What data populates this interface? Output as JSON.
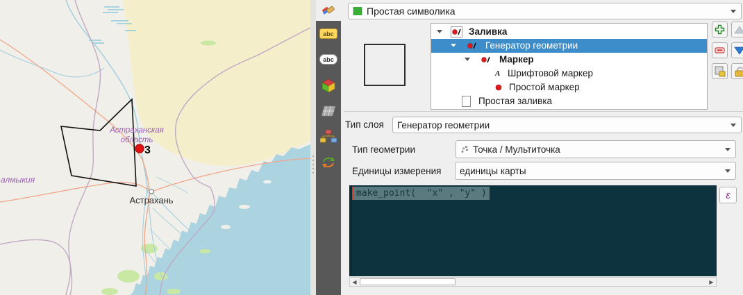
{
  "colors": {
    "selection_blue": "#3c8dca",
    "editor_background": "#0c333e",
    "editor_selection": "#5b7a80",
    "marker_red": "#e31212",
    "map_sand": "#f5eecb",
    "map_water": "#abd4e0",
    "map_green": "#c9e8a4",
    "boundary_purple": "#bfa9c4",
    "road_salmon": "#f0a589"
  },
  "map": {
    "region_label_line1": "Астраханская",
    "region_label_line2": "область",
    "city_label": "Астрахань",
    "area_label": "алмыкия",
    "marker_label": "3"
  },
  "styling_tabs": {
    "labels_tag": "abc",
    "labels_bubble": "abc"
  },
  "panel": {
    "symbology_selector": {
      "value": "Простая символика"
    },
    "symbol_tree": {
      "items": [
        {
          "label": "Заливка"
        },
        {
          "label": "Генератор геометрии"
        },
        {
          "label": "Маркер"
        },
        {
          "label": "Шрифтовой маркер"
        },
        {
          "label": "Простой маркер"
        },
        {
          "label": "Простая заливка"
        }
      ]
    },
    "fields": {
      "layer_type_label": "Тип слоя",
      "layer_type_value": "Генератор геометрии",
      "geometry_type_label": "Тип геометрии",
      "geometry_type_value": "Точка / Мультиточка",
      "units_label": "Единицы измерения",
      "units_value": "единицы карты"
    },
    "expression": {
      "code": "make_point(  \"x\" , \"y\" )",
      "epsilon_button": "ε"
    }
  }
}
